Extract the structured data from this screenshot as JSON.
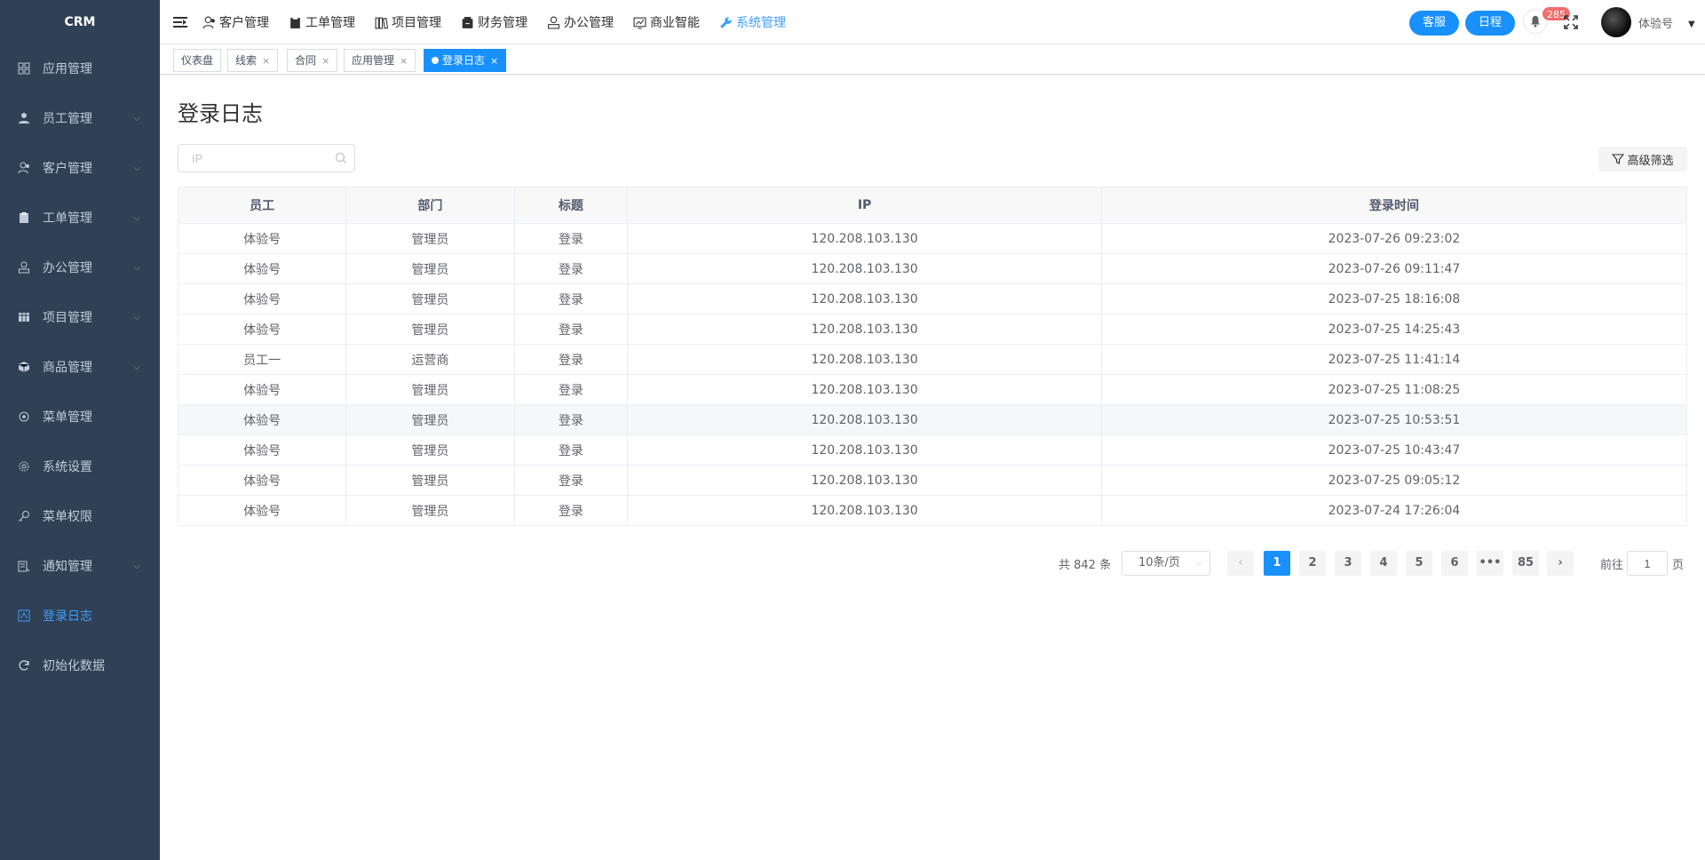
{
  "app": {
    "title": "CRM"
  },
  "sidebar": {
    "items": [
      {
        "label": "应用管理",
        "icon": "grid-icon",
        "has_children": false,
        "active": false
      },
      {
        "label": "员工管理",
        "icon": "user-icon",
        "has_children": true,
        "active": false
      },
      {
        "label": "客户管理",
        "icon": "customer-icon",
        "has_children": true,
        "active": false
      },
      {
        "label": "工单管理",
        "icon": "clipboard-icon",
        "has_children": true,
        "active": false
      },
      {
        "label": "办公管理",
        "icon": "office-icon",
        "has_children": true,
        "active": false
      },
      {
        "label": "项目管理",
        "icon": "project-icon",
        "has_children": true,
        "active": false
      },
      {
        "label": "商品管理",
        "icon": "box-icon",
        "has_children": true,
        "active": false
      },
      {
        "label": "菜单管理",
        "icon": "menu-icon",
        "has_children": false,
        "active": false
      },
      {
        "label": "系统设置",
        "icon": "gear-icon",
        "has_children": false,
        "active": false
      },
      {
        "label": "菜单权限",
        "icon": "key-icon",
        "has_children": false,
        "active": false
      },
      {
        "label": "通知管理",
        "icon": "notice-icon",
        "has_children": true,
        "active": false
      },
      {
        "label": "登录日志",
        "icon": "log-icon",
        "has_children": false,
        "active": true
      },
      {
        "label": "初始化数据",
        "icon": "refresh-icon",
        "has_children": false,
        "active": false
      }
    ]
  },
  "topnav": {
    "items": [
      {
        "label": "客户管理",
        "icon": "customer-icon",
        "active": false
      },
      {
        "label": "工单管理",
        "icon": "clipboard-icon",
        "active": false
      },
      {
        "label": "项目管理",
        "icon": "books-icon",
        "active": false
      },
      {
        "label": "财务管理",
        "icon": "finance-icon",
        "active": false
      },
      {
        "label": "办公管理",
        "icon": "office-icon",
        "active": false
      },
      {
        "label": "商业智能",
        "icon": "chart-icon",
        "active": false
      },
      {
        "label": "系统管理",
        "icon": "wrench-icon",
        "active": true
      }
    ],
    "service_label": "客服",
    "schedule_label": "日程",
    "notification_count": "285",
    "username": "体验号"
  },
  "tags": [
    {
      "label": "仪表盘",
      "closable": false,
      "active": false
    },
    {
      "label": "线索",
      "closable": true,
      "active": false
    },
    {
      "label": "合同",
      "closable": true,
      "active": false
    },
    {
      "label": "应用管理",
      "closable": true,
      "active": false
    },
    {
      "label": "登录日志",
      "closable": true,
      "active": true
    }
  ],
  "page": {
    "title": "登录日志",
    "search_placeholder": "IP",
    "advanced_filter_label": "高级筛选"
  },
  "table": {
    "columns": [
      "员工",
      "部门",
      "标题",
      "IP",
      "登录时间"
    ],
    "rows": [
      [
        "体验号",
        "管理员",
        "登录",
        "120.208.103.130",
        "2023-07-26 09:23:02"
      ],
      [
        "体验号",
        "管理员",
        "登录",
        "120.208.103.130",
        "2023-07-26 09:11:47"
      ],
      [
        "体验号",
        "管理员",
        "登录",
        "120.208.103.130",
        "2023-07-25 18:16:08"
      ],
      [
        "体验号",
        "管理员",
        "登录",
        "120.208.103.130",
        "2023-07-25 14:25:43"
      ],
      [
        "员工一",
        "运营商",
        "登录",
        "120.208.103.130",
        "2023-07-25 11:41:14"
      ],
      [
        "体验号",
        "管理员",
        "登录",
        "120.208.103.130",
        "2023-07-25 11:08:25"
      ],
      [
        "体验号",
        "管理员",
        "登录",
        "120.208.103.130",
        "2023-07-25 10:53:51"
      ],
      [
        "体验号",
        "管理员",
        "登录",
        "120.208.103.130",
        "2023-07-25 10:43:47"
      ],
      [
        "体验号",
        "管理员",
        "登录",
        "120.208.103.130",
        "2023-07-25 09:05:12"
      ],
      [
        "体验号",
        "管理员",
        "登录",
        "120.208.103.130",
        "2023-07-24 17:26:04"
      ]
    ],
    "highlighted_row": 6
  },
  "pagination": {
    "total_text": "共 842 条",
    "page_size": "10条/页",
    "pages": [
      "1",
      "2",
      "3",
      "4",
      "5",
      "6",
      "•••",
      "85"
    ],
    "current_page": "1",
    "jump_prefix": "前往",
    "jump_value": "1",
    "jump_suffix": "页"
  },
  "colors": {
    "sidebar_bg": "#304156",
    "sidebar_text": "#bfcbd9",
    "accent": "#1890ff",
    "active_menu": "#409eff",
    "badge": "#f56c6c"
  }
}
